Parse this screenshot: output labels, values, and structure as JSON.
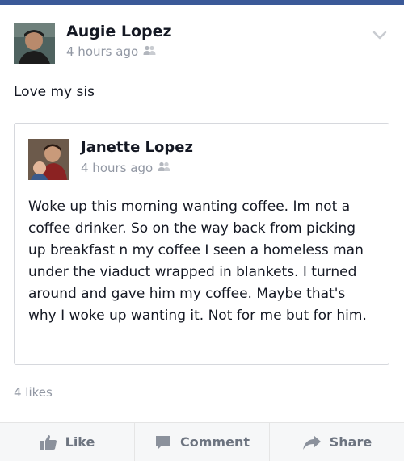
{
  "post": {
    "author": "Augie Lopez",
    "timestamp": "4 hours ago",
    "audience_icon": "friends-icon",
    "menu_icon": "chevron-down-icon",
    "text": "Love my sis"
  },
  "shared_post": {
    "author": "Janette Lopez",
    "timestamp": "4 hours ago",
    "audience_icon": "friends-icon",
    "text": "Woke up this morning wanting coffee. Im not a coffee drinker. So on the way back from picking up breakfast n my coffee I seen a homeless man under the viaduct wrapped in blankets. I turned around and gave him my coffee. Maybe that's why I woke up wanting it. Not for me but for him."
  },
  "likes_count": "4 likes",
  "actions": {
    "like_label": "Like",
    "comment_label": "Comment",
    "share_label": "Share"
  },
  "colors": {
    "brand": "#3b5998",
    "muted_text": "#9197a3",
    "action_text": "#6d7480"
  }
}
